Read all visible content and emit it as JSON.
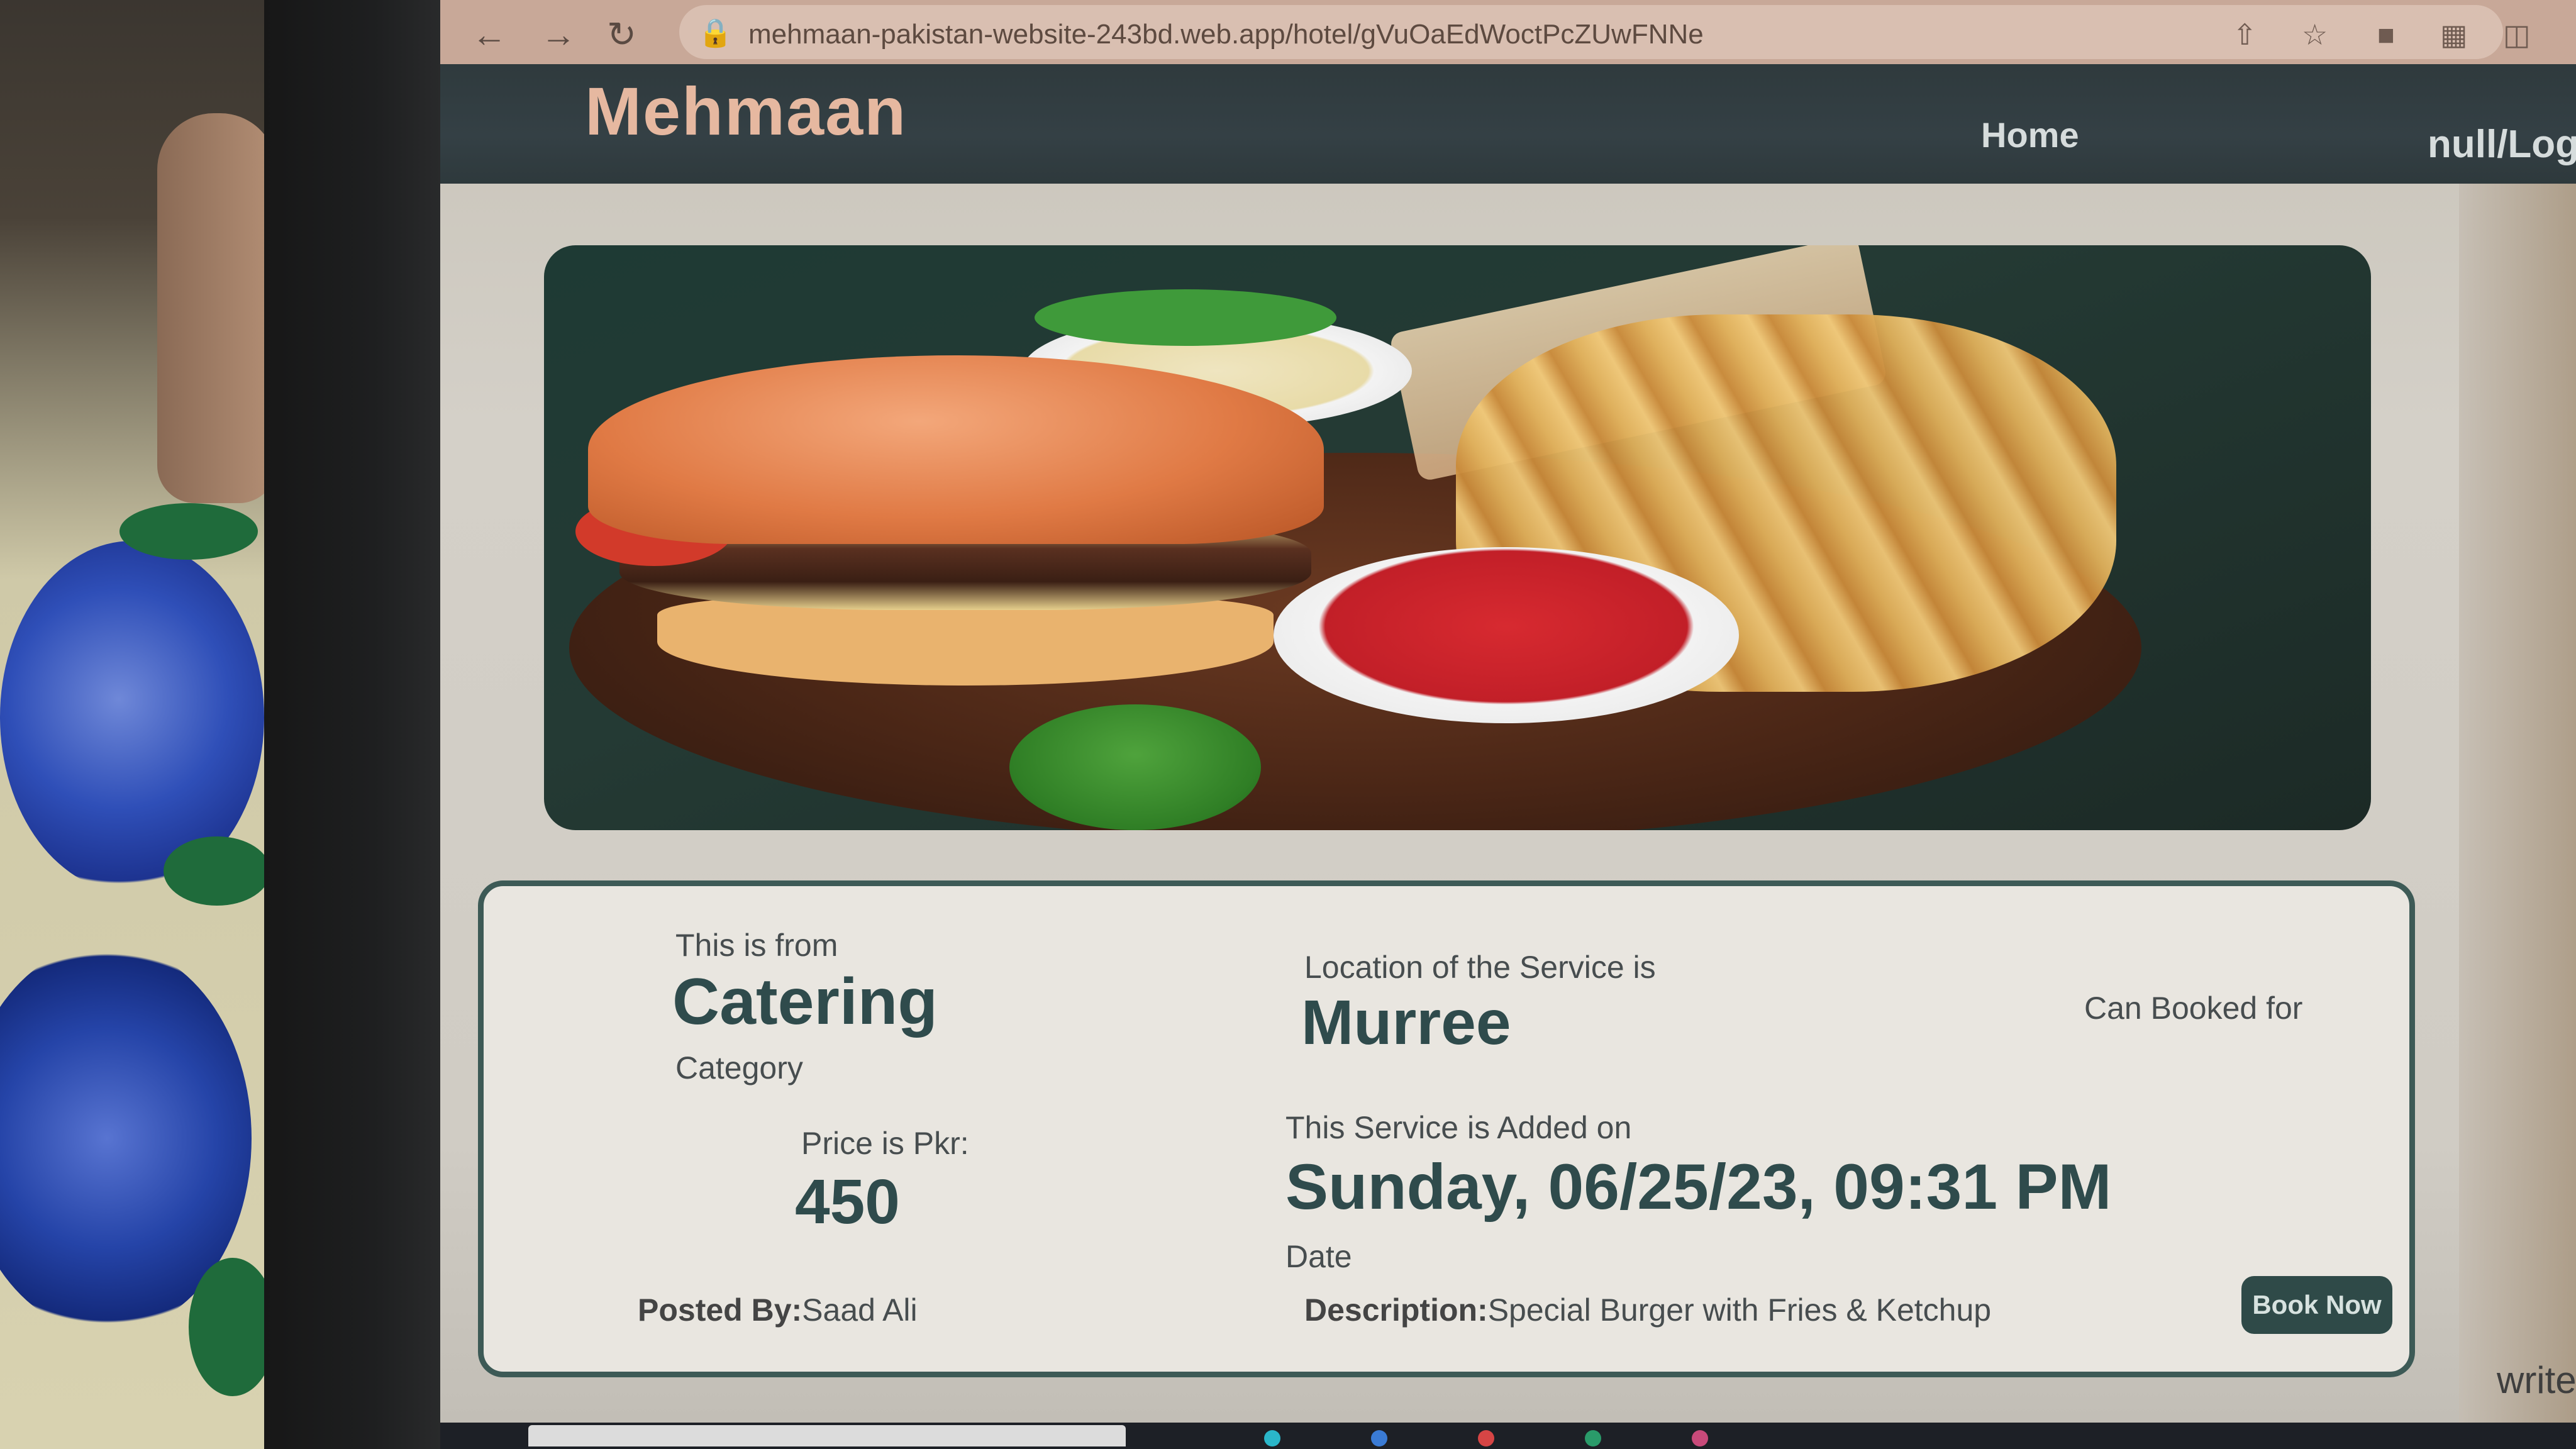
{
  "browser": {
    "url": "mehmaan-pakistan-website-243bd.web.app/hotel/gVuOaEdWoctPcZUwFNNe"
  },
  "site": {
    "brand": "Mehmaan",
    "nav": {
      "home": "Home",
      "login": "null/Log"
    }
  },
  "listing": {
    "category_intro": "This is from",
    "category": "Catering",
    "category_suffix": "Category",
    "location_intro": "Location of the Service is",
    "location": "Murree",
    "booked_for_label": "Can Booked for",
    "price_label": "Price is Pkr:",
    "price": "450",
    "added_intro": "This Service is Added on",
    "added_date": "Sunday, 06/25/23, 09:31 PM",
    "date_suffix": "Date",
    "posted_by_label": "Posted By:",
    "posted_by": "Saad Ali",
    "description_label": "Description:",
    "description": "Special Burger with Fries & Ketchup",
    "book_button": "Book Now"
  },
  "footer_partial_text": "write",
  "colors": {
    "header_bg": "#344045",
    "brand_text": "#e6b8a0",
    "card_border": "#3d5a56",
    "value_text": "#2f4b4c",
    "button_bg": "#2f4a48"
  }
}
